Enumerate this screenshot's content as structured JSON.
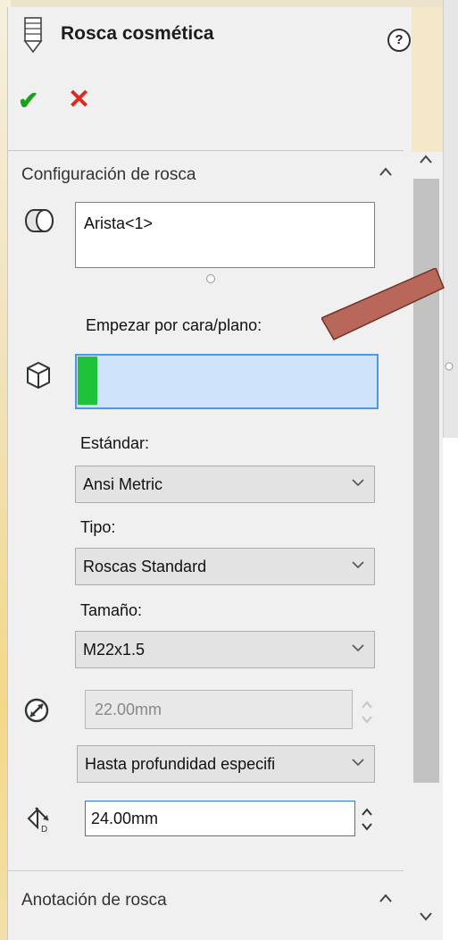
{
  "header": {
    "title": "Rosca cosmética",
    "help": "?",
    "ok_icon": "check-icon",
    "cancel_icon": "close-icon"
  },
  "group": {
    "title": "Configuración de rosca"
  },
  "edge": {
    "value": "Arista<1>"
  },
  "start": {
    "label": "Empezar por cara/plano:"
  },
  "standard": {
    "label": "Estándar:",
    "value": "Ansi Metric"
  },
  "type": {
    "label": "Tipo:",
    "value": "Roscas Standard"
  },
  "size": {
    "label": "Tamaño:",
    "value": "M22x1.5"
  },
  "diameter": {
    "value": "22.00mm"
  },
  "end_condition": {
    "value": "Hasta profundidad especifi"
  },
  "depth": {
    "value": "24.00mm"
  },
  "annotation": {
    "title": "Anotación de rosca"
  },
  "colors": {
    "accept": "#1aa31a",
    "cancel": "#e0291e",
    "arrow": "#b8675a",
    "selection": "#cfe3fb",
    "marker": "#1ec33a"
  }
}
